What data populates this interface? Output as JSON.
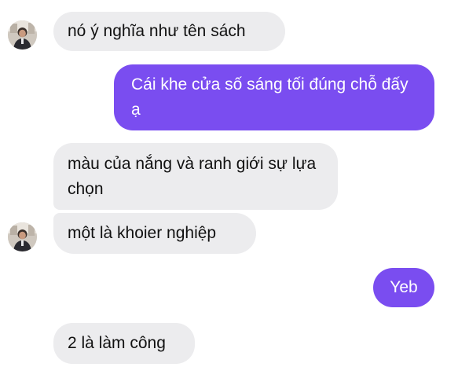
{
  "messages": [
    {
      "sender": "other",
      "text": "nó ý nghĩa như tên sách"
    },
    {
      "sender": "me",
      "text": "Cái khe cửa số sáng tối đúng chỗ đấy ạ"
    },
    {
      "sender": "other",
      "text": "màu của nắng và ranh giới sự lựa chọn"
    },
    {
      "sender": "other",
      "text": "một là khoier nghiệp"
    },
    {
      "sender": "me",
      "text": "Yeb"
    },
    {
      "sender": "other",
      "text": "2 là làm công"
    }
  ],
  "colors": {
    "outgoing_bubble": "#7a4df0",
    "incoming_bubble": "#ececee",
    "background": "#ffffff"
  },
  "icons": {
    "avatar": "contact-avatar-photo"
  }
}
